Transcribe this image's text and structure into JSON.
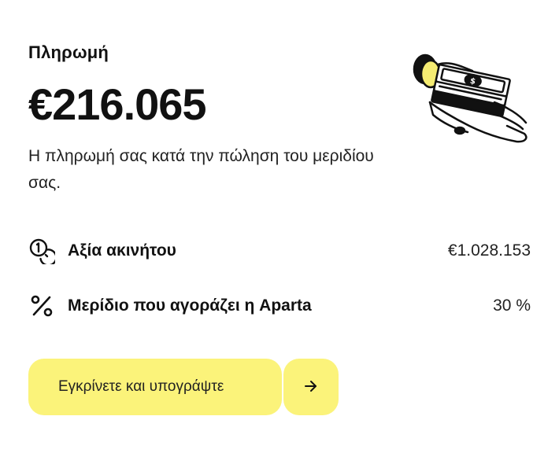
{
  "payment": {
    "title": "Πληρωμή",
    "amount": "€216.065",
    "description": "Η πληρωμή σας κατά την πώληση του μεριδίου σας."
  },
  "illustration": {
    "icon": "hand-holding-money-icon",
    "colors": {
      "accent": "#f5ec72",
      "stroke": "#111111"
    }
  },
  "details": [
    {
      "icon": "coins-icon",
      "label": "Αξία ακινήτου",
      "value": "€1.028.153"
    },
    {
      "icon": "percent-icon",
      "label": "Μερίδιο που αγοράζει η Aparta",
      "value": "30 %"
    }
  ],
  "actions": {
    "approve_label": "Εγκρίνετε και υπογράψτε",
    "arrow_icon": "arrow-right-icon",
    "button_color": "#fbf37a"
  }
}
